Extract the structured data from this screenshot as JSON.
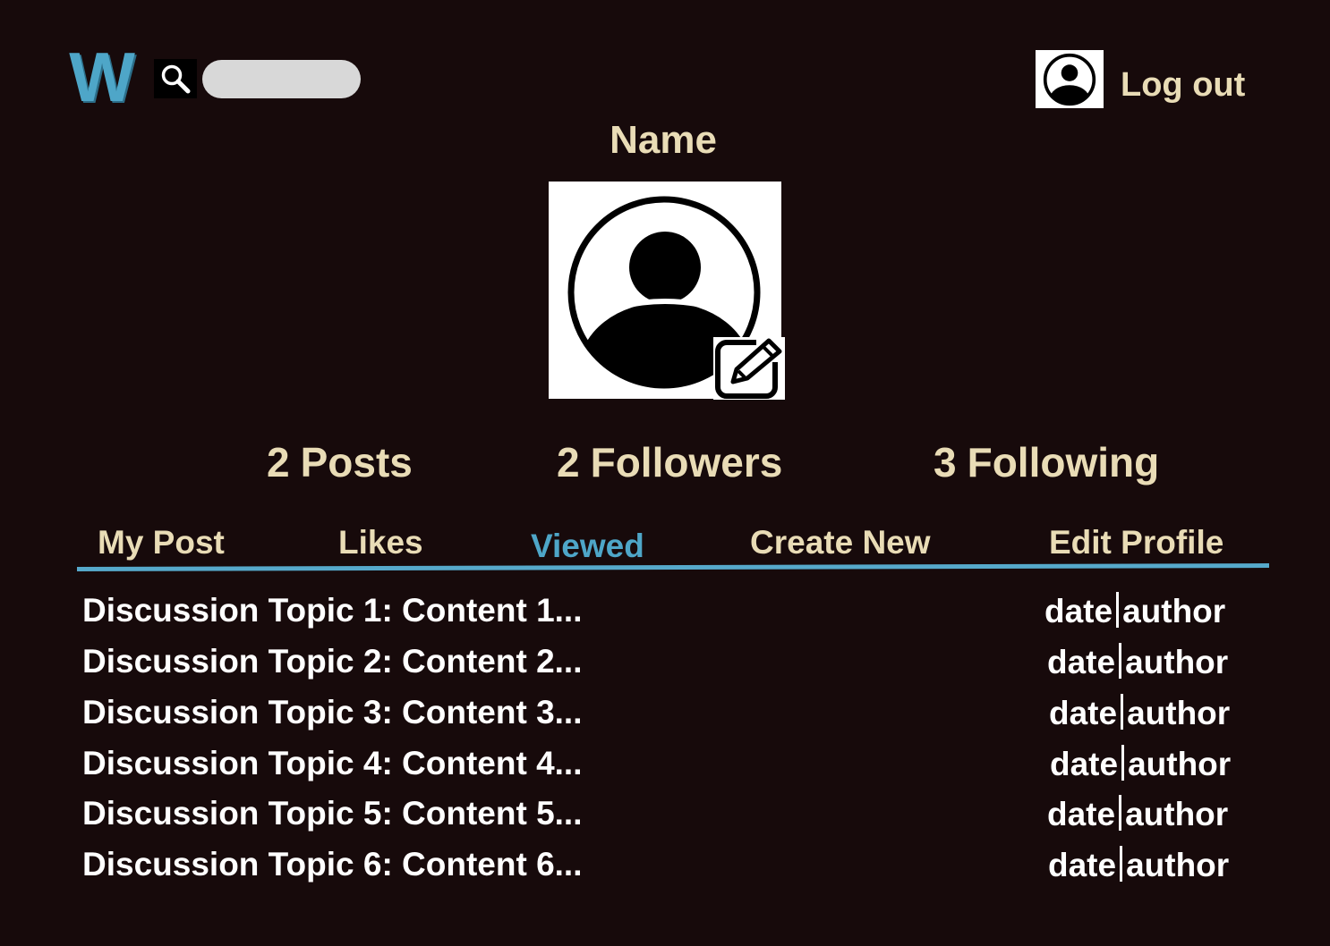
{
  "header": {
    "logo_text": "W",
    "search": {
      "value": "",
      "placeholder": ""
    },
    "logout_label": "Log out"
  },
  "profile": {
    "name": "Name"
  },
  "stats": [
    {
      "count": "2",
      "label": "Posts"
    },
    {
      "count": "2",
      "label": "Followers"
    },
    {
      "count": "3",
      "label": "Following"
    }
  ],
  "tabs": [
    {
      "label": "My Post",
      "active": false
    },
    {
      "label": "Likes",
      "active": false
    },
    {
      "label": "Viewed",
      "active": true
    },
    {
      "label": "Create New",
      "active": false
    },
    {
      "label": "Edit Profile",
      "active": false
    }
  ],
  "posts": [
    {
      "title": "Discussion Topic 1: Content 1...",
      "date": "date",
      "author": "author"
    },
    {
      "title": "Discussion Topic 2: Content 2...",
      "date": "date",
      "author": "author"
    },
    {
      "title": "Discussion Topic 3: Content 3...",
      "date": "date",
      "author": "author"
    },
    {
      "title": "Discussion Topic 4: Content 4...",
      "date": "date",
      "author": "author"
    },
    {
      "title": "Discussion Topic 5: Content 5...",
      "date": "date",
      "author": "author"
    },
    {
      "title": "Discussion Topic 6: Content 6...",
      "date": "date",
      "author": "author"
    }
  ],
  "colors": {
    "background": "#170a0b",
    "accent": "#4ea6c8",
    "text_primary": "#e9dcb6",
    "text_list": "#ffffff"
  },
  "icons": {
    "logo": "w-logo-icon",
    "search": "search-icon",
    "header_avatar": "user-avatar-icon",
    "profile_photo": "user-avatar-icon",
    "edit_photo": "edit-pencil-icon"
  }
}
